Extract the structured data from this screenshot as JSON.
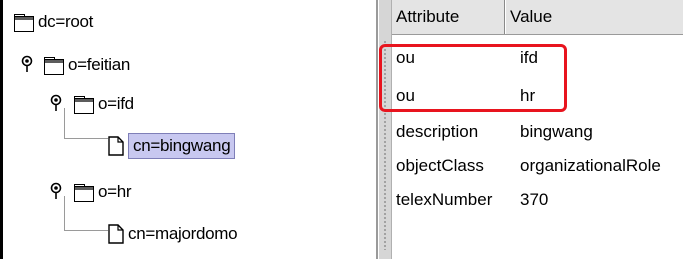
{
  "tree": {
    "nodes": [
      {
        "label": "dc=root",
        "icon": "folder-icon"
      },
      {
        "label": "o=feitian",
        "icon": "folder-icon"
      },
      {
        "label": "o=ifd",
        "icon": "folder-icon"
      },
      {
        "label": "cn=bingwang",
        "icon": "document-icon",
        "selected": true
      },
      {
        "label": "o=hr",
        "icon": "folder-icon"
      },
      {
        "label": "cn=majordomo",
        "icon": "document-icon"
      }
    ]
  },
  "table": {
    "headers": {
      "attribute": "Attribute",
      "value": "Value"
    },
    "rows": [
      {
        "attribute": "ou",
        "value": "ifd"
      },
      {
        "attribute": "ou",
        "value": "hr"
      },
      {
        "attribute": "description",
        "value": "bingwang"
      },
      {
        "attribute": "objectClass",
        "value": "organizationalRole"
      },
      {
        "attribute": "telexNumber",
        "value": "370"
      }
    ]
  },
  "colors": {
    "highlight": "#e8141e",
    "selection": "#c8c8f0"
  }
}
